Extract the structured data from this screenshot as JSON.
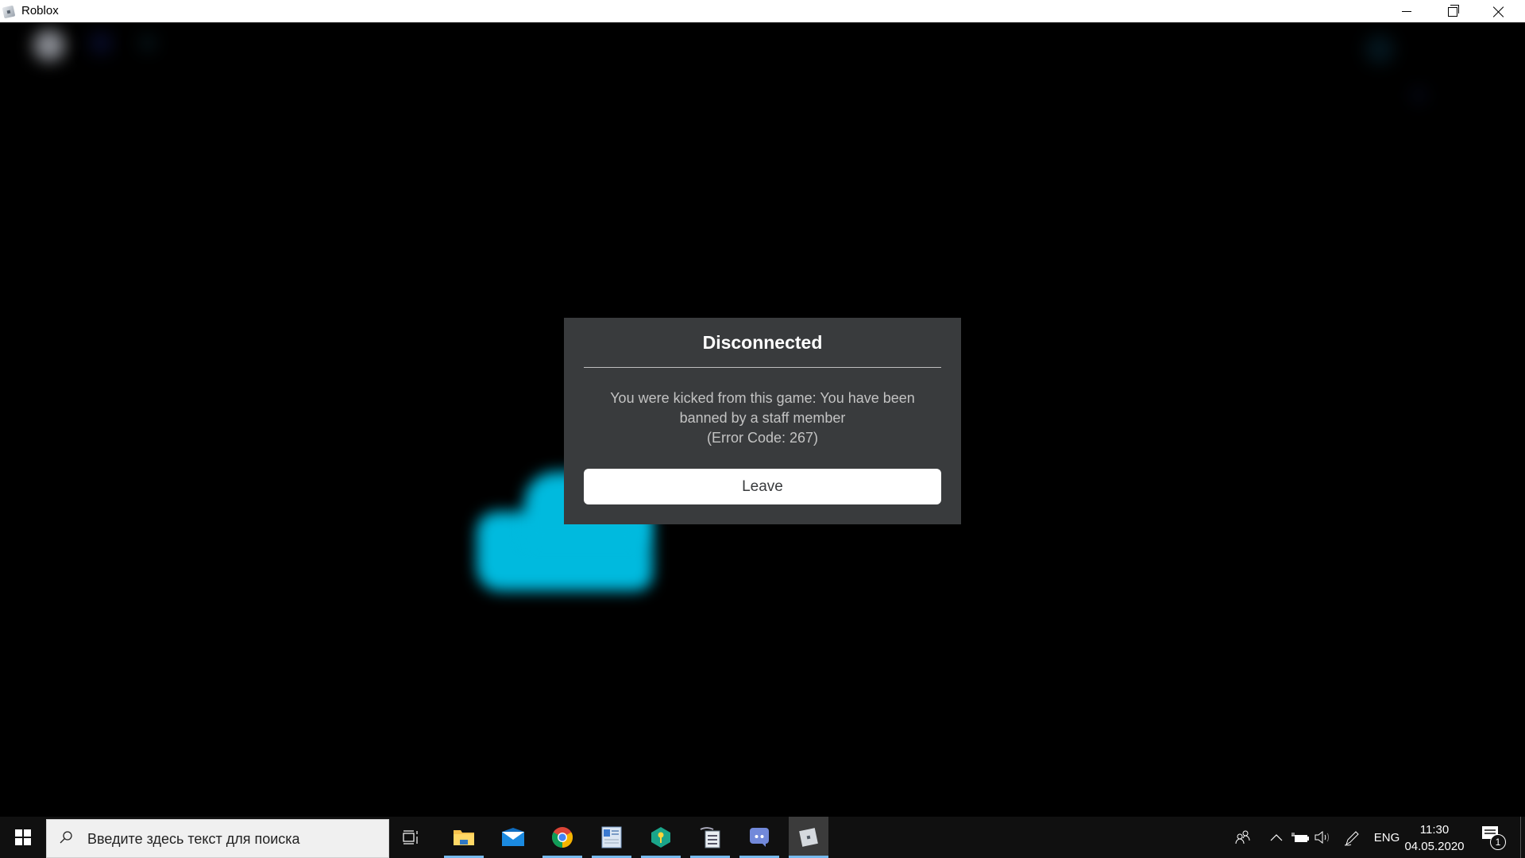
{
  "window": {
    "title": "Roblox",
    "controls": {
      "minimize": "minimize",
      "maximize": "restore",
      "close": "close"
    }
  },
  "dialog": {
    "title": "Disconnected",
    "message_line1": "You were kicked from this game: You have been",
    "message_line2": "banned by a staff member",
    "error_code": "(Error Code: 267)",
    "leave_label": "Leave"
  },
  "taskbar": {
    "search_placeholder": "Введите здесь текст для поиска",
    "apps": [
      {
        "name": "file-explorer",
        "icon": "folder-icon",
        "running": true
      },
      {
        "name": "mail",
        "icon": "mail-icon",
        "running": false
      },
      {
        "name": "chrome",
        "icon": "chrome-icon",
        "running": true
      },
      {
        "name": "wordpad",
        "icon": "wordpad-icon",
        "running": true
      },
      {
        "name": "kaspersky-password",
        "icon": "key-shield-icon",
        "running": true
      },
      {
        "name": "text-editor",
        "icon": "document-icon",
        "running": true
      },
      {
        "name": "discord",
        "icon": "discord-icon",
        "running": true
      },
      {
        "name": "roblox",
        "icon": "roblox-icon",
        "running": true,
        "active": true
      }
    ],
    "tray": {
      "language": "ENG",
      "time": "11:30",
      "date": "04.05.2020",
      "notification_count": "1"
    }
  },
  "colors": {
    "dialog_bg": "#393b3d",
    "accent_blob": "#00bade",
    "taskbar_indicator": "#76b9ed"
  }
}
